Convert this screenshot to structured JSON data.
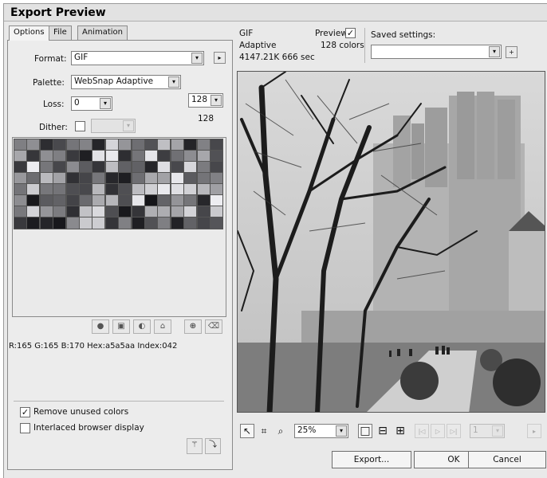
{
  "window": {
    "title": "Export Preview"
  },
  "tabs": [
    {
      "label": "Options",
      "active": true
    },
    {
      "label": "File",
      "active": false
    },
    {
      "label": "Animation",
      "active": false
    }
  ],
  "options": {
    "format_label": "Format:",
    "format_value": "GIF",
    "palette_label": "Palette:",
    "palette_value": "WebSnap Adaptive",
    "loss_label": "Loss:",
    "loss_value": "0",
    "dither_label": "Dither:",
    "dither_checked": false,
    "colors_value": "128",
    "colors_count": "128"
  },
  "color_info": "R:165 G:165 B:170 Hex:a5a5aa Index:042",
  "checkboxes": {
    "remove_unused_label": "Remove unused colors",
    "remove_unused_checked": true,
    "interlaced_label": "Interlaced browser display",
    "interlaced_checked": false
  },
  "preview_info": {
    "format": "GIF",
    "palette": "Adaptive",
    "size_time": "4147.21K  666 sec",
    "preview_label": "Preview",
    "preview_checked": true,
    "colors_text": "128 colors"
  },
  "saved_settings": {
    "label": "Saved settings:",
    "value": ""
  },
  "zoom": {
    "value": "25%"
  },
  "frame": {
    "value": "1"
  },
  "buttons": {
    "export": "Export...",
    "ok": "OK",
    "cancel": "Cancel"
  },
  "icons": {
    "checkmark": "✓",
    "chevron_down": "▾",
    "arrow_right": "▸",
    "plus": "+",
    "pointer": "↖",
    "crop": "⌗",
    "zoom": "⌕",
    "single_view": "□",
    "two_views": "⊟",
    "four_views": "⊞",
    "first_frame": "|◁",
    "play": "▷",
    "last_frame": "▷|",
    "wand": "⚚",
    "export_wizard": "⤵"
  }
}
